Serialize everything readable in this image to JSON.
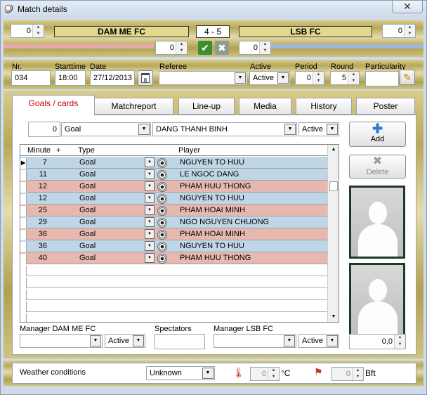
{
  "window": {
    "title": "Match details"
  },
  "header": {
    "home_score_left": "0",
    "home_team": "DAM ME FC",
    "score": "4  - 5",
    "away_team": "LSB FC",
    "away_score_right": "0",
    "home_sub_score": "0",
    "away_sub_score": "0"
  },
  "info": {
    "nr_label": "Nr.",
    "nr_value": "034",
    "starttime_label": "Starttime",
    "starttime_value": "18:00",
    "date_label": "Date",
    "date_value": "27/12/2013",
    "calendar_icon_text": "8",
    "referee_label": "Referee",
    "referee_value": "",
    "active_label": "Active",
    "active_value": "Active",
    "period_label": "Period",
    "period_value": "0",
    "round_label": "Round",
    "round_value": "5",
    "particularity_label": "Particularity",
    "particularity_value": ""
  },
  "tabs": [
    {
      "label": "Goals / cards",
      "active": true
    },
    {
      "label": "Matchreport"
    },
    {
      "label": "Line-up"
    },
    {
      "label": "Media"
    },
    {
      "label": "History"
    },
    {
      "label": "Poster"
    }
  ],
  "entry": {
    "minute": "0",
    "type": "Goal",
    "player": "DANG THANH BINH",
    "status": "Active"
  },
  "buttons": {
    "add": "Add",
    "delete": "Delete"
  },
  "grid": {
    "headers": [
      "Minute",
      "+",
      "Type",
      "Player"
    ],
    "rows": [
      {
        "minute": "7",
        "type": "Goal",
        "player": "NGUYEN TO HUU",
        "color": "blue"
      },
      {
        "minute": "11",
        "type": "Goal",
        "player": "LE NGOC DANG",
        "color": "blue"
      },
      {
        "minute": "12",
        "type": "Goal",
        "player": "PHAM HUU THONG",
        "color": "pink"
      },
      {
        "minute": "12",
        "type": "Goal",
        "player": "NGUYEN TO HUU",
        "color": "blue"
      },
      {
        "minute": "25",
        "type": "Goal",
        "player": "PHAM HOAI MINH",
        "color": "pink"
      },
      {
        "minute": "29",
        "type": "Goal",
        "player": "NGO NGUYEN CHUONG",
        "color": "blue"
      },
      {
        "minute": "36",
        "type": "Goal",
        "player": "PHAM HOAI MINH",
        "color": "pink"
      },
      {
        "minute": "36",
        "type": "Goal",
        "player": "NGUYEN TO HUU",
        "color": "blue"
      },
      {
        "minute": "40",
        "type": "Goal",
        "player": "PHAM HUU THONG",
        "color": "pink"
      }
    ]
  },
  "bottom": {
    "manager_home_label": "Manager DAM ME FC",
    "manager_home_value": "",
    "manager_home_status": "Active",
    "spectators_label": "Spectators",
    "spectators_value": "",
    "manager_away_label": "Manager LSB FC",
    "manager_away_value": "",
    "manager_away_status": "Active",
    "rating_value": "0,0"
  },
  "weather": {
    "label": "Weather conditions",
    "condition": "Unknown",
    "temp_value": "0",
    "temp_unit": "°C",
    "wind_value": "0",
    "wind_unit": "Bft"
  },
  "colors": {
    "accent_tab": "#c00000",
    "row_blue": "#bfd6e6",
    "row_pink": "#e6b8b0",
    "gold": "#b8a859"
  }
}
